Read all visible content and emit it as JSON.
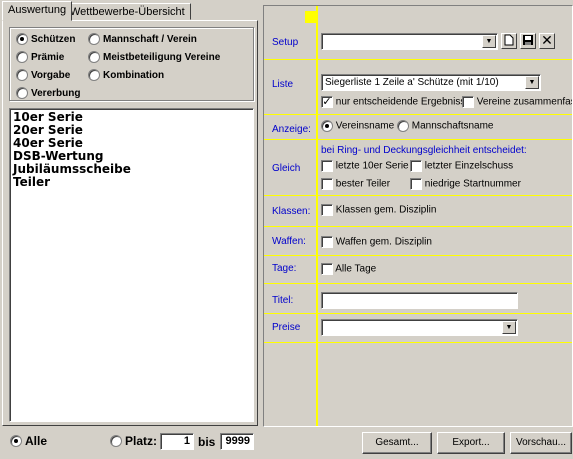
{
  "tabs": [
    {
      "label": "Auswertung",
      "active": true
    },
    {
      "label": "Wettbewerbe-Übersicht",
      "active": false
    }
  ],
  "radio_group": {
    "items": [
      {
        "label": "Schützen",
        "selected": true
      },
      {
        "label": "Mannschaft / Verein",
        "selected": false
      },
      {
        "label": "Prämie",
        "selected": false
      },
      {
        "label": "Meistbeteiligung Vereine",
        "selected": false
      },
      {
        "label": "Vorgabe",
        "selected": false
      },
      {
        "label": "Kombination",
        "selected": false
      },
      {
        "label": "Vererbung",
        "selected": false
      }
    ]
  },
  "list": {
    "items": [
      "10er Serie",
      "20er Serie",
      "40er Serie",
      "DSB-Wertung",
      "Jubiläumsscheibe",
      "Teiler"
    ]
  },
  "bottom": {
    "all_label": "Alle",
    "platz_label": "Platz:",
    "platz_from": "1",
    "bis_label": "bis",
    "platz_to": "9999"
  },
  "form": {
    "setup_label": "Setup",
    "setup_value": "",
    "liste_label": "Liste",
    "liste_value": "Siegerliste 1 Zeile a' Schütze (mit 1/10)",
    "nur_entscheidende": "nur entscheidende Ergebnisse",
    "nur_entscheidende_checked": true,
    "vereine_zusammen": "Vereine zusammenfassen",
    "anzeige_label": "Anzeige:",
    "vereinsname": "Vereinsname",
    "mannschaftsname": "Mannschaftsname",
    "gleich_label": "Gleich",
    "gleich_hint": "bei Ring- und Deckungsgleichheit entscheidet:",
    "letzte_serie": "letzte 10er Serie",
    "letzter_einzelschuss": "letzter Einzelschuss",
    "bester_teiler": "bester Teiler",
    "niedrige_startnummer": "niedrige Startnummer",
    "klassen_label": "Klassen:",
    "klassen_disziplin": "Klassen gem. Disziplin",
    "waffen_label": "Waffen:",
    "waffen_disziplin": "Waffen gem. Disziplin",
    "tage_label": "Tage:",
    "alle_tage": "Alle Tage",
    "titel_label": "Titel:",
    "titel_value": "",
    "preise_label": "Preise",
    "preise_value": ""
  },
  "buttons": {
    "gesamt": "Gesamt...",
    "export": "Export...",
    "vorschau": "Vorschau..."
  },
  "colors": {
    "guide": "#ffff00",
    "label_blue": "#0000cc",
    "background": "#d4d0c8"
  }
}
